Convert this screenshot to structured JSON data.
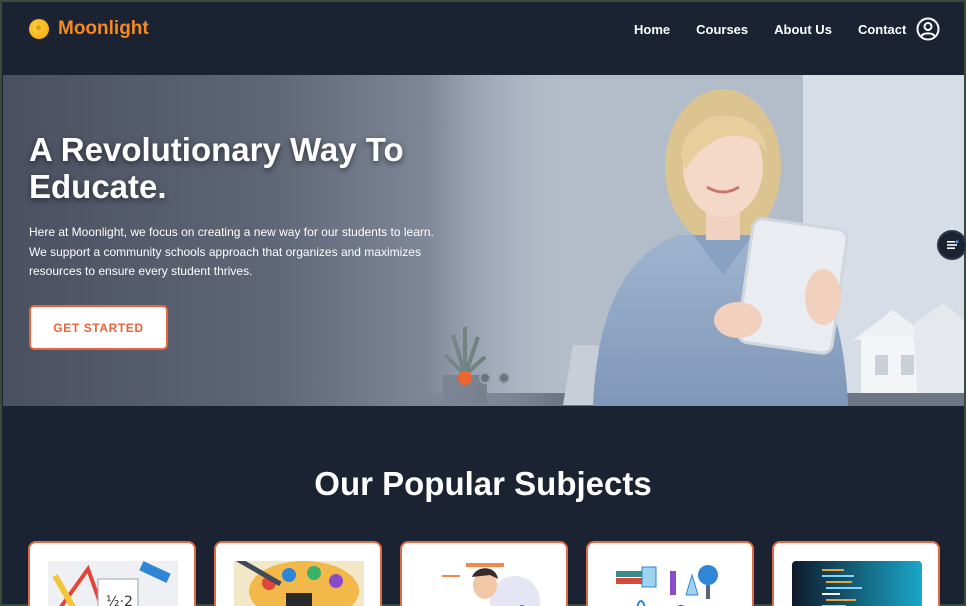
{
  "brand": {
    "name": "Moonlight",
    "icon": "moon-logo-icon"
  },
  "nav": {
    "items": [
      {
        "label": "Home"
      },
      {
        "label": "Courses"
      },
      {
        "label": "About Us"
      },
      {
        "label": "Contact"
      }
    ],
    "user_icon": "user-circle-icon"
  },
  "hero": {
    "title": "A Revolutionary Way To Educate.",
    "text": "Here at Moonlight, we focus on creating a new way for our students to learn. We support a community schools approach that organizes and maximizes resources to ensure every student thrives.",
    "cta_label": "GET STARTED",
    "slides": 3,
    "active_slide": 1
  },
  "subjects": {
    "title": "Our Popular Subjects",
    "cards": [
      {
        "icon": "math-supplies-icon"
      },
      {
        "icon": "art-palette-icon"
      },
      {
        "icon": "reading-person-icon"
      },
      {
        "icon": "science-lab-icon"
      },
      {
        "icon": "code-screen-icon"
      }
    ]
  },
  "colors": {
    "accent": "#f0642f",
    "brand": "#f58a1f",
    "background": "#1b2232"
  }
}
